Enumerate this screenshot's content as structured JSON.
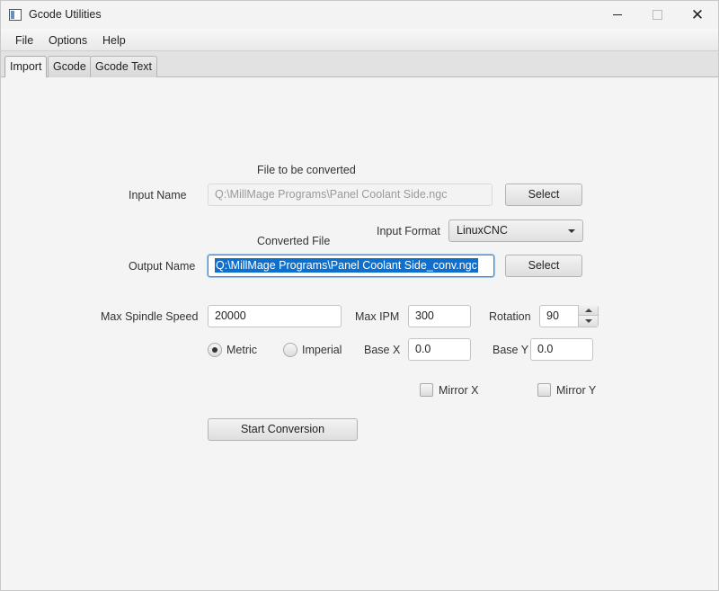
{
  "window": {
    "title": "Gcode Utilities",
    "minimize_glyph": "",
    "maximize_glyph": "",
    "close_glyph": "✕"
  },
  "menu": [
    "File",
    "Options",
    "Help"
  ],
  "tabs": [
    {
      "label": "Import",
      "active": true
    },
    {
      "label": "Gcode",
      "active": false
    },
    {
      "label": "Gcode Text",
      "active": false
    }
  ],
  "form": {
    "input_header": "File to be converted",
    "input_label": "Input Name",
    "input_value": "Q:\\MillMage Programs\\Panel Coolant Side.ngc",
    "input_select": "Select",
    "format_label": "Input Format",
    "format_value": "LinuxCNC",
    "output_header": "Converted File",
    "output_label": "Output Name",
    "output_value": "Q:\\MillMage Programs\\Panel Coolant Side_conv.ngc",
    "output_select": "Select",
    "spindle_label": "Max Spindle Speed",
    "spindle_value": "20000",
    "ipm_label": "Max IPM",
    "ipm_value": "300",
    "rotation_label": "Rotation",
    "rotation_value": "90",
    "metric_label": "Metric",
    "imperial_label": "Imperial",
    "units_selected": "Metric",
    "basex_label": "Base X",
    "basex_value": "0.0",
    "basey_label": "Base Y",
    "basey_value": "0.0",
    "mirrorx_label": "Mirror X",
    "mirrorx_checked": false,
    "mirrory_label": "Mirror Y",
    "mirrory_checked": false,
    "start_button": "Start Conversion"
  },
  "icons": {
    "app": "app-window-icon",
    "format_dropdown": "chevron-down-icon",
    "spin_up": "triangle-up-icon",
    "spin_down": "triangle-down-icon"
  }
}
